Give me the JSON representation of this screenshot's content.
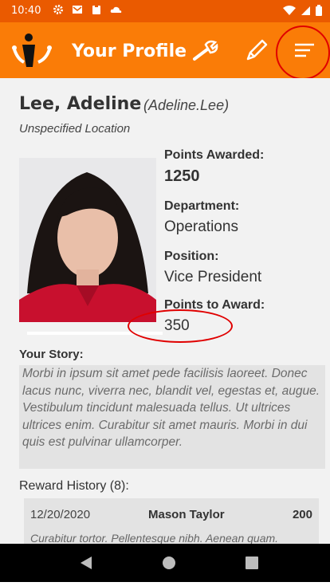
{
  "status_bar": {
    "time": "10:40",
    "notification_icons": [
      "gear-icon",
      "mail-icon",
      "clipboard-icon",
      "cloud-icon"
    ],
    "system_icons": [
      "wifi-icon",
      "signal-icon",
      "battery-icon"
    ]
  },
  "app_bar": {
    "title": "Your Profile",
    "actions": [
      "wrench-icon",
      "pencil-icon",
      "menu-icon"
    ],
    "accent_color": "#fa7c07"
  },
  "profile": {
    "name": "Lee, Adeline",
    "username": "(Adeline.Lee)",
    "location": "Unspecified Location",
    "points_awarded_label": "Points Awarded:",
    "points_awarded": "1250",
    "department_label": "Department:",
    "department": "Operations",
    "position_label": "Position:",
    "position": "Vice President",
    "points_to_award_label": "Points to Award:",
    "points_to_award": "350"
  },
  "story": {
    "label": "Your Story:",
    "text": "Morbi in ipsum sit amet pede facilisis laoreet. Donec lacus nunc, viverra nec, blandit vel, egestas et, augue. Vestibulum tincidunt malesuada tellus. Ut ultrices ultrices enim. Curabitur sit amet mauris. Morbi in dui quis est pulvinar ullamcorper."
  },
  "reward_history": {
    "label": "Reward History (8):",
    "items": [
      {
        "date": "12/20/2020",
        "from": "Mason Taylor",
        "points": "200",
        "comment": "Curabitur tortor. Pellentesque nibh. Aenean quam."
      }
    ]
  },
  "nav_bar": [
    "back-icon",
    "home-icon",
    "recents-icon"
  ]
}
